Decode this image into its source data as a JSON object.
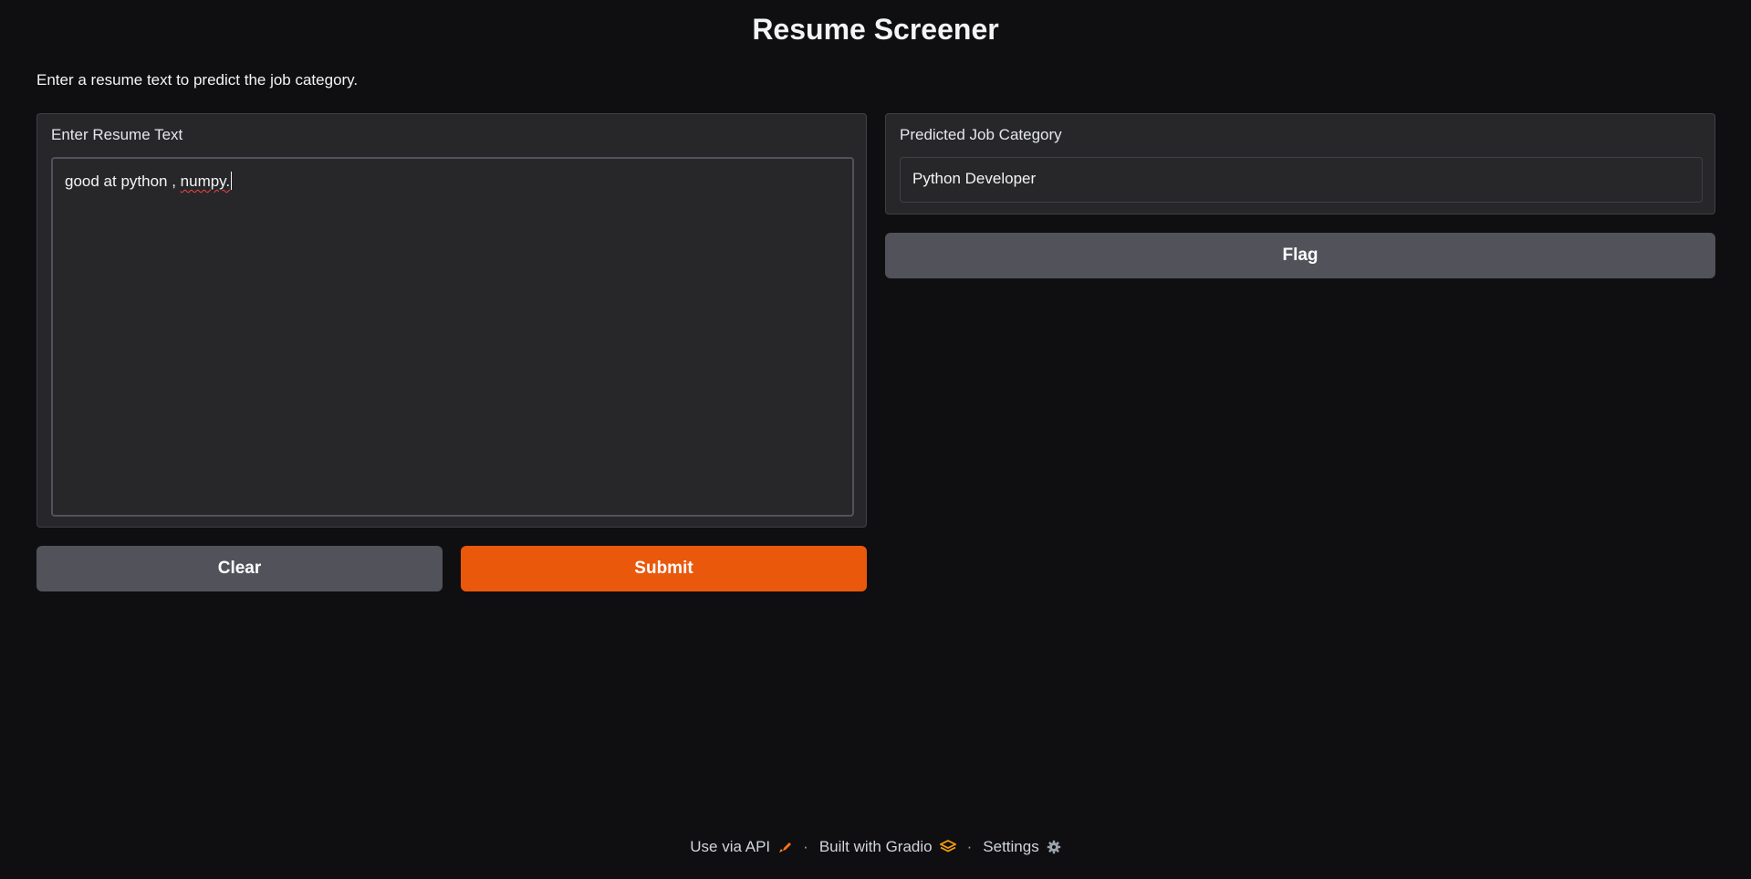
{
  "app": {
    "title": "Resume Screener",
    "description": "Enter a resume text to predict the job category."
  },
  "input": {
    "label": "Enter Resume Text",
    "value_prefix": "good at python , ",
    "value_misspelled": "numpy."
  },
  "output": {
    "label": "Predicted Job Category",
    "value": "Python Developer"
  },
  "buttons": {
    "clear": "Clear",
    "submit": "Submit",
    "flag": "Flag"
  },
  "footer": {
    "api": "Use via API",
    "built": "Built with Gradio",
    "settings": "Settings",
    "separator": "·"
  },
  "icons": {
    "api": "rocket-icon",
    "gradio": "gradio-logo-icon",
    "settings": "gear-icon"
  },
  "colors": {
    "background": "#0f0f11",
    "panel": "#27272a",
    "primary": "#ea580c",
    "secondary": "#52525b"
  }
}
